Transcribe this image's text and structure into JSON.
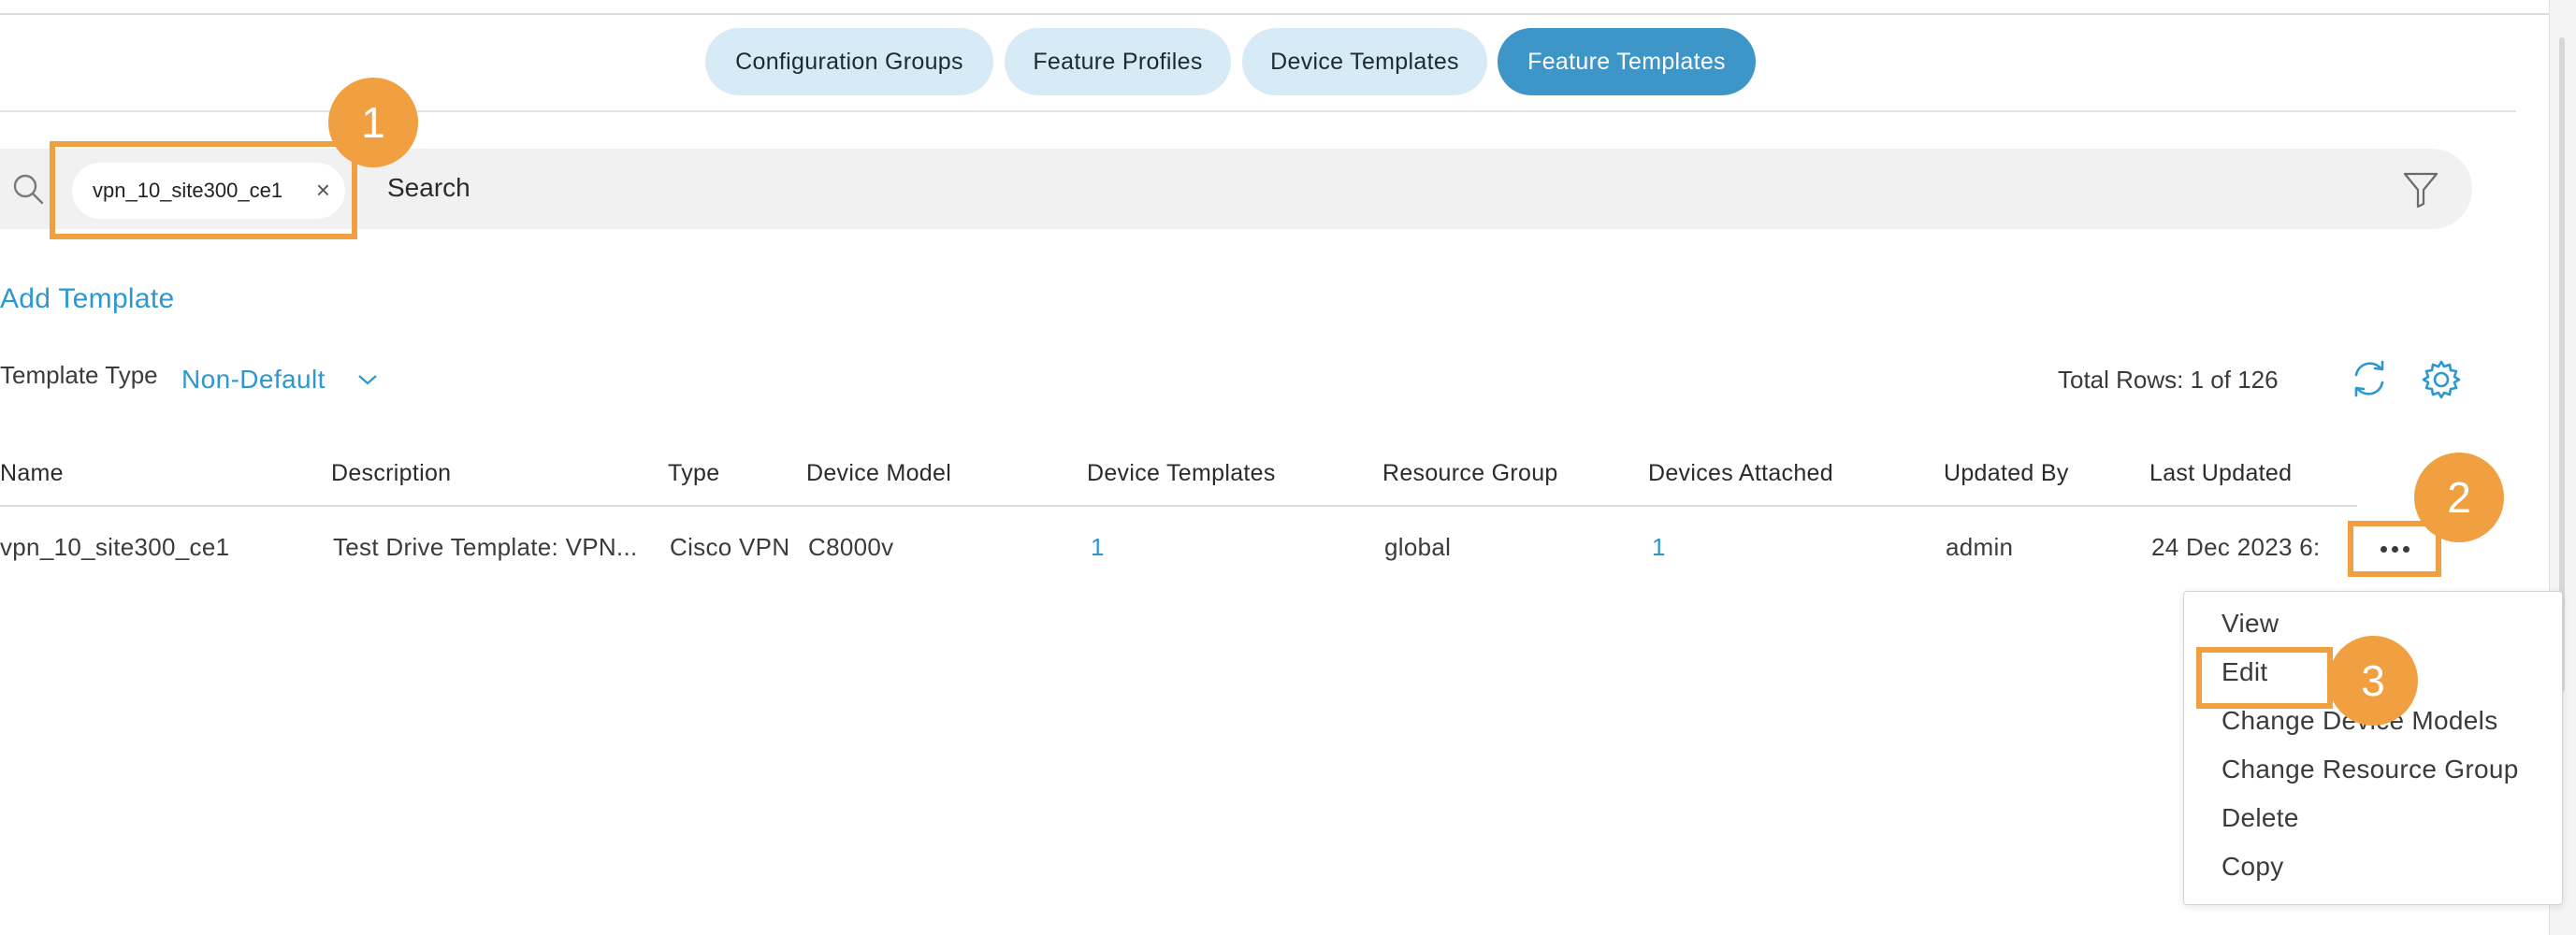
{
  "tabs": [
    {
      "label": "Configuration Groups",
      "active": false
    },
    {
      "label": "Feature Profiles",
      "active": false
    },
    {
      "label": "Device Templates",
      "active": false
    },
    {
      "label": "Feature Templates",
      "active": true
    }
  ],
  "search": {
    "chip_value": "vpn_10_site300_ce1",
    "chip_remove": "×",
    "placeholder": "Search"
  },
  "actions": {
    "add_template": "Add Template"
  },
  "template_type": {
    "label": "Template Type",
    "value": "Non-Default"
  },
  "total_rows": "Total Rows: 1 of 126",
  "table": {
    "columns": [
      "Name",
      "Description",
      "Type",
      "Device Model",
      "Device Templates",
      "Resource Group",
      "Devices Attached",
      "Updated By",
      "Last Updated"
    ],
    "rows": [
      {
        "name": "vpn_10_site300_ce1",
        "description": "Test Drive Template: VPN...",
        "type": "Cisco VPN",
        "device_model": "C8000v",
        "device_templates": "1",
        "resource_group": "global",
        "devices_attached": "1",
        "updated_by": "admin",
        "last_updated": "24 Dec 2023 6:"
      }
    ]
  },
  "row_menu": {
    "items": [
      "View",
      "Edit",
      "Change Device Models",
      "Change Resource Group",
      "Delete",
      "Copy"
    ]
  },
  "annotations": {
    "badge1": "1",
    "badge2": "2",
    "badge3": "3"
  },
  "colors": {
    "accent": "#2c98cf",
    "active_tab": "#3d95c8",
    "tab": "#d6ebf6",
    "highlight": "#f0a040"
  },
  "icons": [
    "search-icon",
    "close-icon",
    "filter-icon",
    "chevron-down-icon",
    "refresh-icon",
    "gear-icon",
    "more-icon"
  ]
}
